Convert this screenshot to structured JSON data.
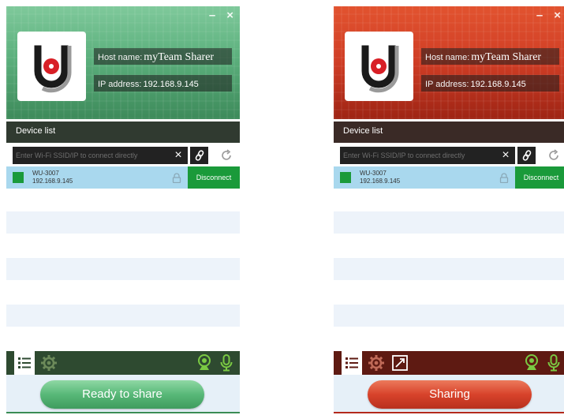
{
  "colors": {
    "ready_accent": "#5cb07d",
    "sharing_accent": "#cf3d25",
    "connected_green": "#1a9a3a",
    "device_row_bg": "#a9d8ee"
  },
  "panels": [
    {
      "state": "ready",
      "window_controls": {
        "minimize": "–",
        "close": "×"
      },
      "host_label": "Host name:",
      "host_value": "myTeam Sharer",
      "ip_label": "IP address:",
      "ip_value": "192.168.9.145",
      "device_list_title": "Device list",
      "search_placeholder": "Enter Wi-Fi SSID/IP to connect directly",
      "clear_icon": "×",
      "device": {
        "name": "WU-3007",
        "ip": "192.168.9.145"
      },
      "disconnect_label": "Disconnect",
      "toolbar_icons": [
        "list-icon",
        "gear-icon",
        "webcam-icon",
        "microphone-icon"
      ],
      "share_button_label": "Ready to share"
    },
    {
      "state": "sharing",
      "window_controls": {
        "minimize": "–",
        "close": "×"
      },
      "host_label": "Host name:",
      "host_value": "myTeam Sharer",
      "ip_label": "IP address:",
      "ip_value": "192.168.9.145",
      "device_list_title": "Device list",
      "search_placeholder": "Enter Wi-Fi SSID/IP to connect directly",
      "clear_icon": "×",
      "device": {
        "name": "WU-3007",
        "ip": "192.168.9.145"
      },
      "disconnect_label": "Disconnect",
      "toolbar_icons": [
        "list-icon",
        "gear-icon",
        "screen-extend-icon",
        "webcam-icon",
        "microphone-icon"
      ],
      "share_button_label": "Sharing"
    }
  ]
}
